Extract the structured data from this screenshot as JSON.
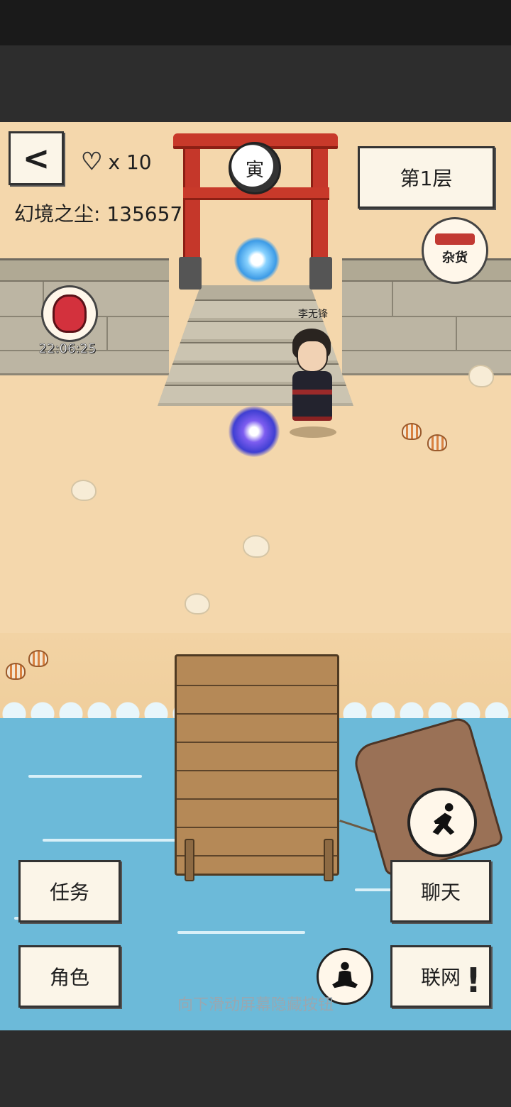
{
  "hud": {
    "back_label": "<",
    "lives_multiplier": "x 10",
    "dust_label": "幻境之尘: 135657",
    "floor_label": "第1层"
  },
  "shop": {
    "label": "杂货"
  },
  "torii": {
    "medallion_text": "寅"
  },
  "gift": {
    "timer": "22:06:25"
  },
  "character": {
    "name": "李无锋"
  },
  "buttons": {
    "task": "任务",
    "role": "角色",
    "chat": "聊天",
    "network": "联网"
  },
  "alert": {
    "symbol": "!"
  },
  "hint_text": "向下滑动屏幕隐藏按钮",
  "colors": {
    "sand": "#f4d7ac",
    "water": "#6cbad9",
    "torii_red": "#c8392a",
    "button_bg": "#fbf5e8"
  }
}
